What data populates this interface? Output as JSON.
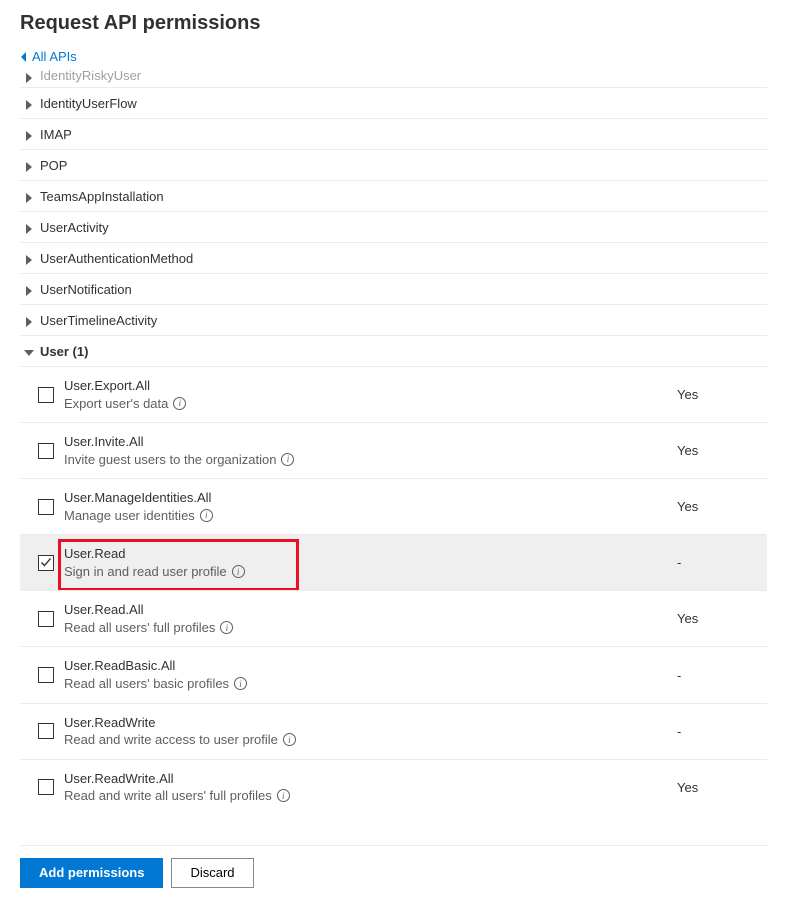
{
  "header": {
    "title": "Request API permissions",
    "back_label": "All APIs"
  },
  "groups": [
    {
      "id": "identityriskyuser",
      "label": "IdentityRiskyUser",
      "expanded": false,
      "partial": true
    },
    {
      "id": "identityuserflow",
      "label": "IdentityUserFlow",
      "expanded": false
    },
    {
      "id": "imap",
      "label": "IMAP",
      "expanded": false
    },
    {
      "id": "pop",
      "label": "POP",
      "expanded": false
    },
    {
      "id": "teamsappinstall",
      "label": "TeamsAppInstallation",
      "expanded": false
    },
    {
      "id": "useractivity",
      "label": "UserActivity",
      "expanded": false
    },
    {
      "id": "userauth",
      "label": "UserAuthenticationMethod",
      "expanded": false
    },
    {
      "id": "usernotif",
      "label": "UserNotification",
      "expanded": false
    },
    {
      "id": "usertimeline",
      "label": "UserTimelineActivity",
      "expanded": false
    },
    {
      "id": "user",
      "label": "User (1)",
      "expanded": true
    }
  ],
  "permissions": [
    {
      "id": "user-export-all",
      "name": "User.Export.All",
      "desc": "Export user's data",
      "checked": false,
      "consent": "Yes",
      "highlight": false
    },
    {
      "id": "user-invite-all",
      "name": "User.Invite.All",
      "desc": "Invite guest users to the organization",
      "checked": false,
      "consent": "Yes",
      "highlight": false
    },
    {
      "id": "user-manageid-all",
      "name": "User.ManageIdentities.All",
      "desc": "Manage user identities",
      "checked": false,
      "consent": "Yes",
      "highlight": false
    },
    {
      "id": "user-read",
      "name": "User.Read",
      "desc": "Sign in and read user profile",
      "checked": true,
      "consent": "-",
      "highlight": true
    },
    {
      "id": "user-read-all",
      "name": "User.Read.All",
      "desc": "Read all users' full profiles",
      "checked": false,
      "consent": "Yes",
      "highlight": false
    },
    {
      "id": "user-readbasic-all",
      "name": "User.ReadBasic.All",
      "desc": "Read all users' basic profiles",
      "checked": false,
      "consent": "-",
      "highlight": false
    },
    {
      "id": "user-readwrite",
      "name": "User.ReadWrite",
      "desc": "Read and write access to user profile",
      "checked": false,
      "consent": "-",
      "highlight": false
    },
    {
      "id": "user-readwrite-all",
      "name": "User.ReadWrite.All",
      "desc": "Read and write all users' full profiles",
      "checked": false,
      "consent": "Yes",
      "highlight": false
    }
  ],
  "footer": {
    "add_label": "Add permissions",
    "discard_label": "Discard"
  }
}
